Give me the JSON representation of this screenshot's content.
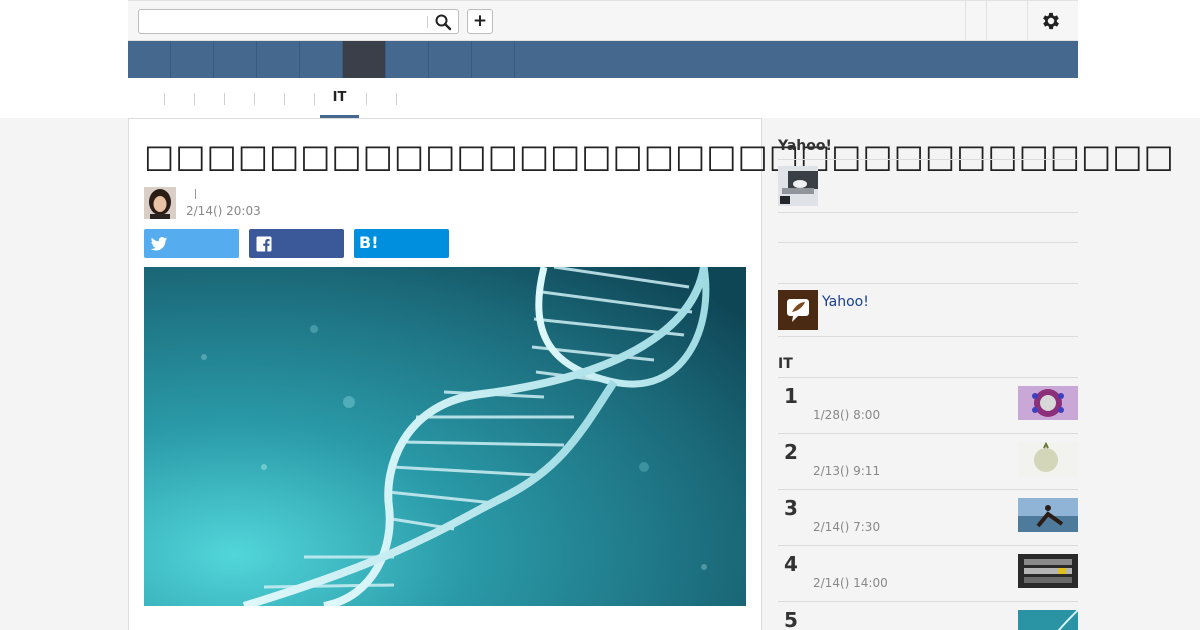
{
  "header": {
    "search": {
      "value": "",
      "placeholder": ""
    },
    "search_icon": "search-icon",
    "add_label": "+",
    "settings_icon": "gear-icon"
  },
  "nav": {
    "items": [
      "",
      "",
      "",
      "",
      "",
      "",
      "",
      "",
      ""
    ],
    "active_index": 5
  },
  "category_tabs": {
    "items": [
      "",
      "",
      "",
      "",
      "",
      "IT",
      "",
      ""
    ],
    "active": "IT"
  },
  "article": {
    "title": "□□□□□□□□□□□□□□□□□□□□□□□□□□□□□□□□□",
    "author_name": "",
    "date": "2/14() 20:03",
    "share": {
      "twitter_icon": "twitter-icon",
      "facebook_icon": "facebook-icon",
      "hatena_label": "B!"
    },
    "hero_image": "dna-double-helix-image"
  },
  "sidebar": {
    "section1_title": "Yahoo!",
    "creator_link": "Yahoo!",
    "ranking_title": "IT",
    "ranking": [
      {
        "rank": "1",
        "date": "1/28() 8:00"
      },
      {
        "rank": "2",
        "date": "2/13() 9:11"
      },
      {
        "rank": "3",
        "date": "2/14() 7:30"
      },
      {
        "rank": "4",
        "date": "2/14() 14:00"
      },
      {
        "rank": "5",
        "date": ""
      }
    ]
  },
  "colors": {
    "nav_bg": "#45688f",
    "nav_active": "#3b3f4a",
    "twitter": "#55acee",
    "facebook": "#3b5998",
    "hatena": "#008fde",
    "link": "#1a3f8f"
  }
}
